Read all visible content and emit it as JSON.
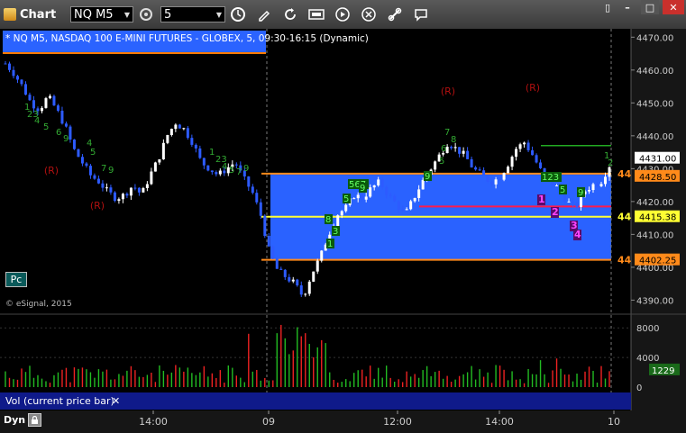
{
  "toolbar": {
    "app_title": "Chart",
    "symbol": "NQ M5",
    "interval": "5",
    "buttons": [
      "clock-icon",
      "pencil-icon",
      "refresh-icon",
      "study-icon",
      "play-icon",
      "cancel-icon",
      "link-icon",
      "comment-icon"
    ]
  },
  "chart_header": "* NQ M5, NASDAQ 100 E-MINI FUTURES - GLOBEX, 5, 09:30-16:15 (Dynamic)",
  "watermark": "© eSignal, 2015",
  "pc_button": "Pc",
  "price_axis": {
    "ticks": [
      "4470.00",
      "4460.00",
      "4450.00",
      "4440.00",
      "4430.00",
      "4420.00",
      "4410.00",
      "4400.00",
      "4390.00"
    ],
    "labels": [
      {
        "text": "4431.00",
        "bg": "#ffffff",
        "fg": "#000000"
      },
      {
        "text": "4428.50",
        "bg": "#ff8a1a",
        "fg": "#000000"
      },
      {
        "text": "4415.38",
        "bg": "#ffff33",
        "fg": "#000000"
      },
      {
        "text": "4402.25",
        "bg": "#ff8a1a",
        "fg": "#000000"
      }
    ],
    "edge_tags": [
      "44",
      "44",
      "44"
    ]
  },
  "volume_axis": {
    "ticks": [
      "8000",
      "4000",
      "0"
    ],
    "current": "1229"
  },
  "volume_panel_label": "Vol (current price bar)",
  "time_axis": [
    "14:00",
    "09",
    "12:00",
    "14:00",
    "10"
  ],
  "status": {
    "label": "Dyn"
  },
  "colors": {
    "zone_fill": "#2a62ff",
    "zone_line": "#ff8a1a",
    "mid_line": "#ffff33",
    "red_line": "#ff1a4a",
    "green_line": "#22aa22",
    "candle": "#2d5bff",
    "candle_up": "#ffffff"
  },
  "chart_data": [
    {
      "type": "candlestick",
      "title": "* NQ M5, NASDAQ 100 E-MINI FUTURES - GLOBEX, 5, 09:30-16:15 (Dynamic)",
      "ylim": [
        4386,
        4472
      ],
      "x_ticks": [
        "14:00",
        "09",
        "12:00",
        "14:00",
        "10"
      ],
      "y_ticks": [
        4470,
        4460,
        4450,
        4440,
        4430,
        4420,
        4410,
        4400,
        4390
      ],
      "close_path": [
        4462,
        4459,
        4455,
        4450,
        4448,
        4452,
        4448,
        4443,
        4436,
        4432,
        4428,
        4426,
        4423,
        4421,
        4422,
        4425,
        4422,
        4428,
        4433,
        4440,
        4444,
        4442,
        4438,
        4432,
        4430,
        4428,
        4430,
        4432,
        4427,
        4423,
        4416,
        4405,
        4399,
        4397,
        4395,
        4391,
        4398,
        4403,
        4410,
        4416,
        4418,
        4422,
        4421,
        4424,
        4426,
        4422,
        4419,
        4416,
        4421,
        4426,
        4430,
        4434,
        4438,
        4436,
        4434,
        4430,
        4428,
        4426,
        4427,
        4431,
        4436,
        4438,
        4434,
        4429,
        4426,
        4424,
        4420,
        4418,
        4423,
        4425,
        4426,
        4431
      ],
      "levels": {
        "upper_zone": 4428.5,
        "mid": 4415.38,
        "lower_zone": 4402.25,
        "last": 4431.0
      }
    },
    {
      "type": "bar",
      "title": "Vol (current price bar)",
      "ylim": [
        0,
        9000
      ],
      "y_ticks": [
        8000,
        4000,
        0
      ],
      "current": 1229
    }
  ]
}
